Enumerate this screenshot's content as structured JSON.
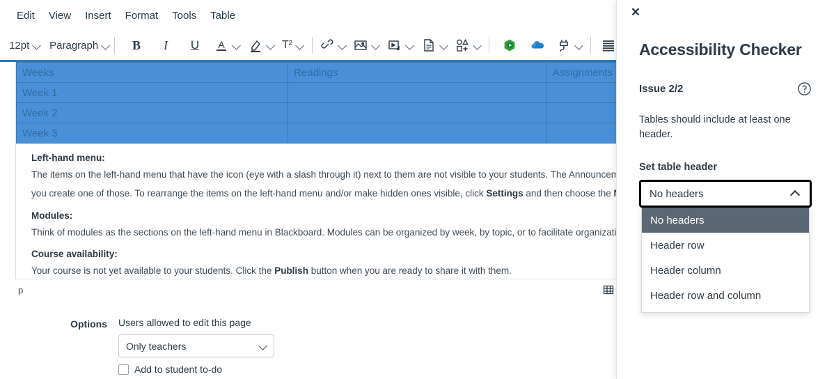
{
  "editor": {
    "menubar": [
      {
        "label": "Edit",
        "name": "menu-edit"
      },
      {
        "label": "View",
        "name": "menu-view"
      },
      {
        "label": "Insert",
        "name": "menu-insert"
      },
      {
        "label": "Format",
        "name": "menu-format"
      },
      {
        "label": "Tools",
        "name": "menu-tools"
      },
      {
        "label": "Table",
        "name": "menu-table"
      }
    ],
    "toolbar": {
      "font_size": "12pt",
      "block_format": "Paragraph",
      "bold": "B",
      "italic": "I",
      "underline": "U",
      "text_color": "A",
      "highlight_color": "highlighter-icon",
      "superscript": "T²",
      "link": "link-icon",
      "image": "image-icon",
      "media": "media-icon",
      "document": "document-icon",
      "shapes": "shapes-icon",
      "studio": "studio-icon",
      "onedrive": "onedrive-icon",
      "plugin": "plugin-icon",
      "align": "align-icon"
    },
    "table": {
      "columns": [
        "Weeks",
        "Readings",
        "Assignments"
      ],
      "rows": [
        [
          "Week 1",
          "",
          ""
        ],
        [
          "Week 2",
          "",
          ""
        ],
        [
          "Week 3",
          "",
          ""
        ]
      ]
    },
    "sections": [
      {
        "heading": "Left-hand menu:",
        "lines": [
          "The items on the left-hand menu that have the icon (eye with a slash through it) next to them are not visible to your students. The Announcements a",
          "you create one of those. To rearrange the items on the left-hand menu and/or make hidden ones visible, click |Settings| and then choose the |Navigatio"
        ]
      },
      {
        "heading": "Modules:",
        "lines": [
          "Think of modules as the sections on the left-hand menu in Blackboard. Modules can be organized by week, by topic, or to facilitate organization (read"
        ]
      },
      {
        "heading": "Course availability:",
        "lines": [
          "Your course is not yet available to your students. Click the |Publish| button when you are ready to share it with them."
        ]
      }
    ],
    "statusbar": {
      "path": "p",
      "table_icon": "table-icon"
    },
    "options": {
      "label": "Options",
      "caption": "Users allowed to edit this page",
      "selected": "Only teachers",
      "checkbox_label": "Add to student to-do"
    }
  },
  "panel": {
    "close_icon": "✕",
    "title": "Accessibility Checker",
    "issue_label": "Issue 2/2",
    "help_icon": "help-icon",
    "issue_description": "Tables should include at least one header.",
    "field_label": "Set table header",
    "combo_value": "No headers",
    "combo_caret": "chevron-up-icon",
    "options": [
      {
        "label": "No headers",
        "selected": true
      },
      {
        "label": "Header row",
        "selected": false
      },
      {
        "label": "Header column",
        "selected": false
      },
      {
        "label": "Header row and column",
        "selected": false
      }
    ]
  },
  "colors": {
    "selection_blue": "#4a90d9",
    "accent_rule": "#2b7abd",
    "option_highlight": "#5b6873",
    "text": "#2d3b45"
  }
}
